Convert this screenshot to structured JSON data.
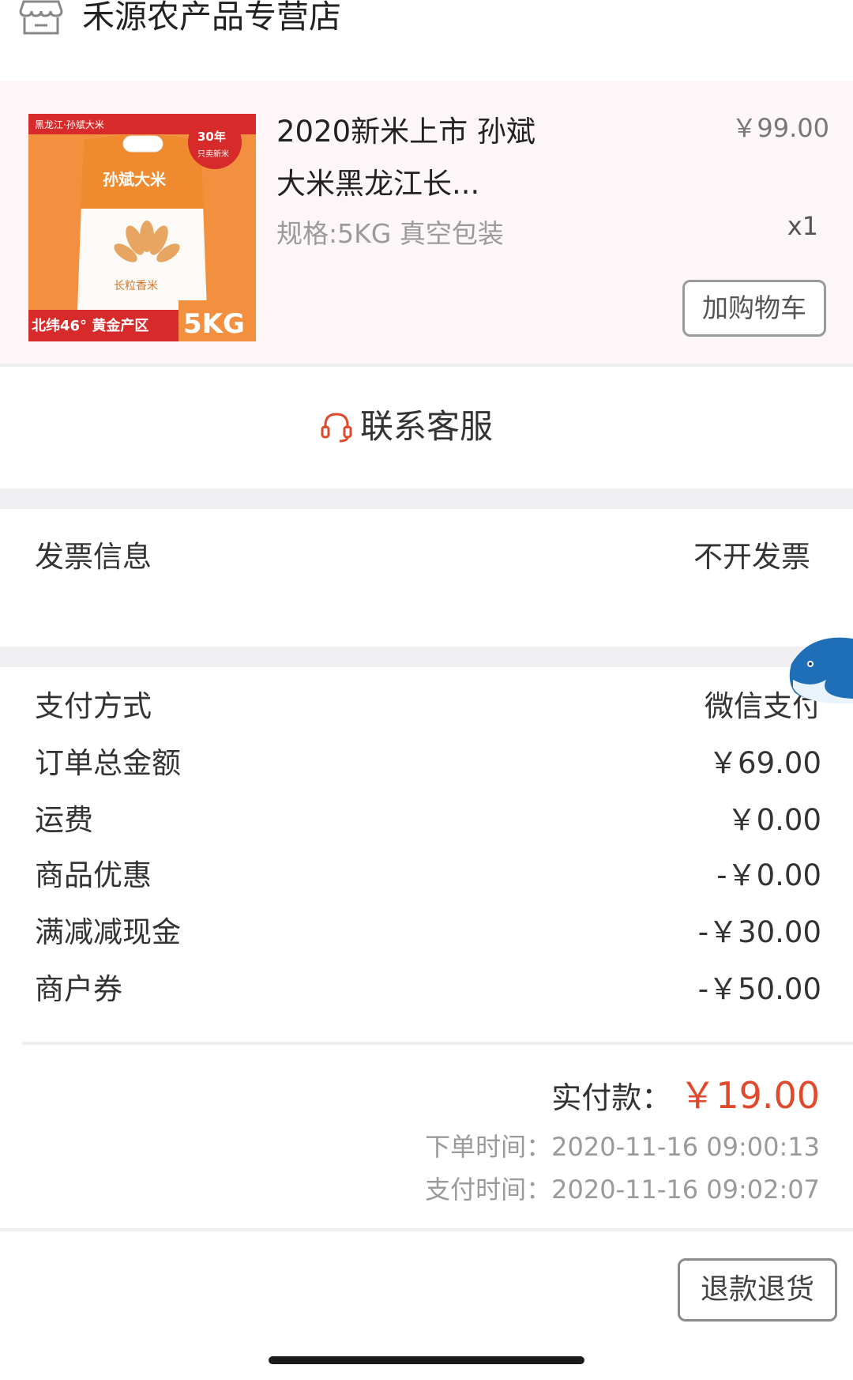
{
  "store": {
    "name": "禾源农产品专营店",
    "icon": "store-icon"
  },
  "product": {
    "title": "2020新米上市 孙斌大米黑龙江长...",
    "spec": "规格:5KG 真空包装",
    "price": "￥99.00",
    "quantity": "x1",
    "add_to_cart_label": "加购物车",
    "image": {
      "top_banner": "黑龙江·孙斌大米",
      "badge_years": "30年",
      "badge_sub": "只卖新米",
      "brand": "孙斌大米",
      "variety": "长粒香米",
      "bottom_banner": "北纬46° 黄金产区",
      "weight": "5KG"
    }
  },
  "service": {
    "label": "联系客服",
    "icon": "headset-icon",
    "icon_color": "#e0492c"
  },
  "invoice": {
    "label": "发票信息",
    "value": "不开发票"
  },
  "summary": {
    "rows": [
      {
        "label": "支付方式",
        "value": "微信支付"
      },
      {
        "label": "订单总金额",
        "value": "￥69.00"
      },
      {
        "label": "运费",
        "value": "￥0.00"
      },
      {
        "label": "商品优惠",
        "value": "-￥0.00"
      },
      {
        "label": "满减减现金",
        "value": "-￥30.00"
      },
      {
        "label": "商户券",
        "value": "-￥50.00"
      }
    ],
    "paid_label": "实付款：",
    "paid_amount": "￥19.00",
    "paid_color": "#e0492c",
    "order_time_label": "下单时间：",
    "order_time": "2020-11-16 09:00:13",
    "pay_time_label": "支付时间：",
    "pay_time": "2020-11-16 09:02:07"
  },
  "actions": {
    "refund_label": "退款退货"
  },
  "floating": {
    "icon": "whale-icon"
  }
}
